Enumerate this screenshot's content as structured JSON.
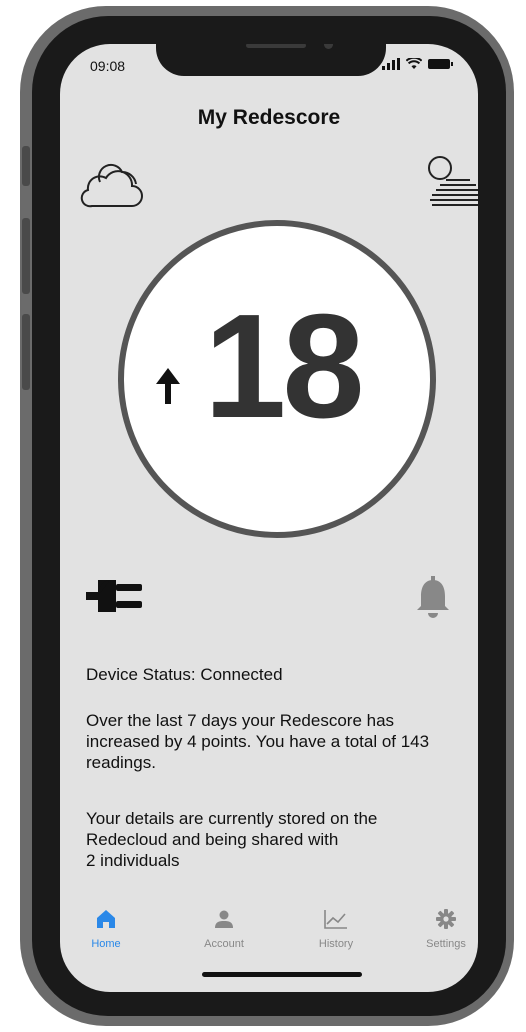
{
  "status_bar": {
    "time": "09:08"
  },
  "header": {
    "title": "My Redescore"
  },
  "score": {
    "value": "18",
    "trend": "up"
  },
  "icons": {
    "cloud": "cloud-icon",
    "weather": "sun-haze-icon",
    "plug": "plug-icon",
    "bell": "bell-icon",
    "trend": "arrow-up-icon"
  },
  "info": {
    "device_status": "Device Status: Connected",
    "summary": "Over the last 7 days your Redescore has increased by 4 points. You have a total of 143 readings.",
    "sharing_line1": "Your details are currently stored on the",
    "sharing_line2": "Redecloud and being shared with",
    "sharing_line3": "2 individuals"
  },
  "tabs": [
    {
      "label": "Home",
      "icon": "home-icon",
      "active": true
    },
    {
      "label": "Account",
      "icon": "person-icon",
      "active": false
    },
    {
      "label": "History",
      "icon": "chart-icon",
      "active": false
    },
    {
      "label": "Settings",
      "icon": "gear-icon",
      "active": false
    }
  ],
  "colors": {
    "accent": "#2a88e8",
    "screen_bg": "#e2e2e2",
    "ring": "#555555"
  }
}
